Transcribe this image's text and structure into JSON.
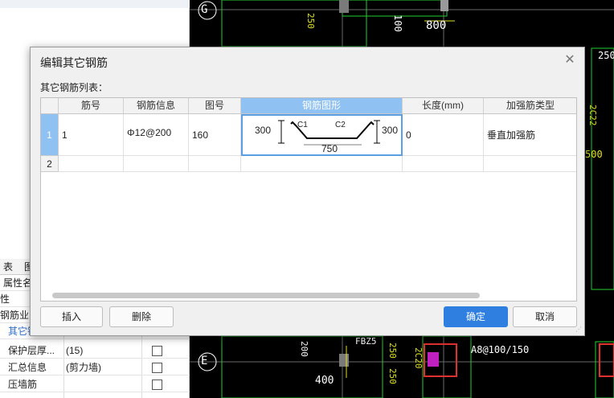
{
  "left_panel": {
    "tabs": [
      "表",
      "图"
    ],
    "rows": [
      {
        "name": "属性名",
        "value": "",
        "check": false
      },
      {
        "name": "性",
        "value": "",
        "check": false
      },
      {
        "name": "钢筋业",
        "value": "",
        "check": false
      },
      {
        "name": "其它钢筋",
        "value": "",
        "check": false
      },
      {
        "name": "保护层厚...",
        "value": "(15)",
        "check": true
      },
      {
        "name": "汇总信息",
        "value": "(剪力墙)",
        "check": true
      },
      {
        "name": "压墙筋",
        "value": "",
        "check": true
      }
    ]
  },
  "cad": {
    "labels": {
      "g_axis": "G",
      "e_axis": "E",
      "dim_100": "100",
      "dim_800": "800",
      "dim_250_a": "250",
      "dim_250_b": "250",
      "dim_400": "400",
      "dim_200": "200",
      "fbz": "FBZ5",
      "a8": "A8@100/150",
      "dim_250_c": "250",
      "dim_250_d": "250",
      "dim_500": "500",
      "dim_2c22": "2C22",
      "dim_2c20": "2C20"
    }
  },
  "dialog": {
    "title": "编辑其它钢筋",
    "subtitle": "其它钢筋列表：",
    "close_icon": "close-icon",
    "columns": [
      "筋号",
      "钢筋信息",
      "图号",
      "钢筋图形",
      "长度(mm)",
      "加强筋类型"
    ],
    "rows": [
      {
        "num": "1",
        "jinhao": "1",
        "info": "Φ12@200",
        "tuhao": "160",
        "length": "0",
        "type": "垂直加强筋"
      },
      {
        "num": "2",
        "jinhao": "",
        "info": "",
        "tuhao": "",
        "length": "",
        "type": ""
      }
    ],
    "shape": {
      "left_dim": "300",
      "right_dim": "300",
      "c1": "C1",
      "c2": "C2",
      "bottom_dim": "750"
    },
    "buttons": {
      "insert": "插入",
      "delete": "删除",
      "ok": "确定",
      "cancel": "取消"
    }
  }
}
